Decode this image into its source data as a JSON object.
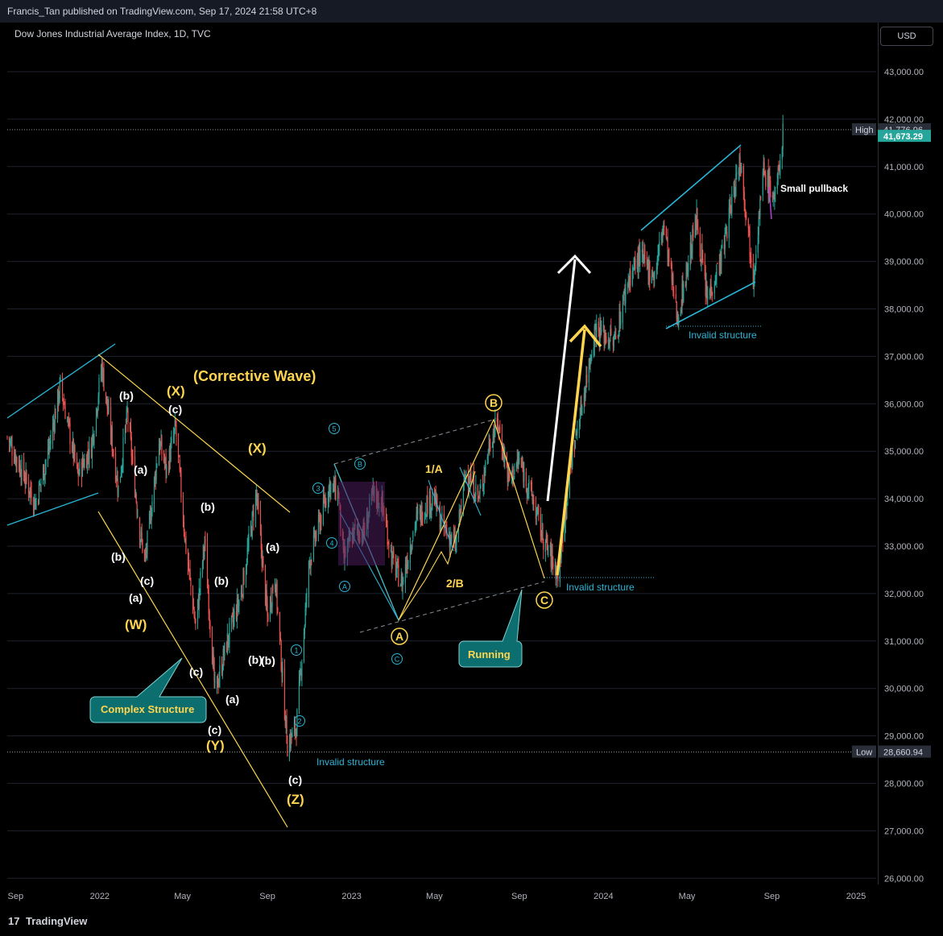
{
  "header": {
    "publish_line": "Francis_Tan published on TradingView.com, Sep 17, 2024 21:58 UTC+8"
  },
  "symbol_line": "Dow Jones Industrial Average Index, 1D, TVC",
  "currency": "USD",
  "footer": {
    "brand": "TradingView"
  },
  "colors": {
    "up": "#26a69a",
    "down": "#ef5350",
    "cyan": "#29b6d8",
    "yellow": "#ffd54f",
    "white": "#ffffff",
    "price_tag": "#26a69a",
    "grid": "#1e222d"
  },
  "chart_data": {
    "type": "candlestick",
    "title": "",
    "y_axis": {
      "ticks": [
        26000,
        27000,
        28000,
        29000,
        30000,
        31000,
        32000,
        33000,
        34000,
        35000,
        36000,
        37000,
        38000,
        39000,
        40000,
        41000,
        42000,
        43000
      ],
      "tick_labels": [
        "26,000.00",
        "27,000.00",
        "28,000.00",
        "29,000.00",
        "30,000.00",
        "31,000.00",
        "32,000.00",
        "33,000.00",
        "34,000.00",
        "35,000.00",
        "36,000.00",
        "37,000.00",
        "38,000.00",
        "39,000.00",
        "40,000.00",
        "41,000.00",
        "42,000.00",
        "43,000.00"
      ],
      "ylim": [
        25800,
        43800
      ]
    },
    "x_axis": {
      "tick_labels": [
        "Sep",
        "2022",
        "May",
        "Sep",
        "2023",
        "May",
        "Sep",
        "2024",
        "May",
        "Sep",
        "2025"
      ],
      "tick_dates": [
        "2021-09-01",
        "2022-01-01",
        "2022-05-01",
        "2022-09-01",
        "2023-01-01",
        "2023-05-01",
        "2023-09-01",
        "2024-01-01",
        "2024-05-01",
        "2024-09-01",
        "2025-01-01"
      ]
    },
    "price_labels": {
      "high_label": "High",
      "high_value": "41,776.96",
      "high": 41776.96,
      "low_label": "Low",
      "low_value": "28,660.94",
      "low": 28660.94,
      "last_value": "41,673.29",
      "last": 41673.29
    },
    "price_path": [
      [
        "2021-08-20",
        35300
      ],
      [
        "2021-09-10",
        34600
      ],
      [
        "2021-09-30",
        33900
      ],
      [
        "2021-10-20",
        35100
      ],
      [
        "2021-11-05",
        36400
      ],
      [
        "2021-11-30",
        34500
      ],
      [
        "2021-12-20",
        35100
      ],
      [
        "2022-01-04",
        36800
      ],
      [
        "2022-01-28",
        34200
      ],
      [
        "2022-02-10",
        35800
      ],
      [
        "2022-02-28",
        33300
      ],
      [
        "2022-03-08",
        32700
      ],
      [
        "2022-03-28",
        35200
      ],
      [
        "2022-04-08",
        34600
      ],
      [
        "2022-04-21",
        35500
      ],
      [
        "2022-05-05",
        33100
      ],
      [
        "2022-05-20",
        31300
      ],
      [
        "2022-06-02",
        33100
      ],
      [
        "2022-06-17",
        29900
      ],
      [
        "2022-07-05",
        31000
      ],
      [
        "2022-07-25",
        32000
      ],
      [
        "2022-08-16",
        34100
      ],
      [
        "2022-09-01",
        31500
      ],
      [
        "2022-09-12",
        32400
      ],
      [
        "2022-09-30",
        28800
      ],
      [
        "2022-10-13",
        29200
      ],
      [
        "2022-11-01",
        32700
      ],
      [
        "2022-11-30",
        34300
      ],
      [
        "2022-12-13",
        34100
      ],
      [
        "2022-12-20",
        32700
      ],
      [
        "2023-01-04",
        33300
      ],
      [
        "2023-01-20",
        33300
      ],
      [
        "2023-02-01",
        34100
      ],
      [
        "2023-02-14",
        33900
      ],
      [
        "2023-03-01",
        32700
      ],
      [
        "2023-03-15",
        32200
      ],
      [
        "2023-04-03",
        33500
      ],
      [
        "2023-04-20",
        33900
      ],
      [
        "2023-05-01",
        34000
      ],
      [
        "2023-05-10",
        33500
      ],
      [
        "2023-06-01",
        33000
      ],
      [
        "2023-06-16",
        34600
      ],
      [
        "2023-07-05",
        34000
      ],
      [
        "2023-07-20",
        35200
      ],
      [
        "2023-08-01",
        35600
      ],
      [
        "2023-08-17",
        34400
      ],
      [
        "2023-09-01",
        34800
      ],
      [
        "2023-09-20",
        34000
      ],
      [
        "2023-10-05",
        33200
      ],
      [
        "2023-10-27",
        32400
      ],
      [
        "2023-11-15",
        34800
      ],
      [
        "2023-12-01",
        36000
      ],
      [
        "2023-12-20",
        37600
      ],
      [
        "2024-01-17",
        37300
      ],
      [
        "2024-02-05",
        38600
      ],
      [
        "2024-02-22",
        39100
      ],
      [
        "2024-03-15",
        38700
      ],
      [
        "2024-03-28",
        39800
      ],
      [
        "2024-04-17",
        37800
      ],
      [
        "2024-05-15",
        39900
      ],
      [
        "2024-05-30",
        38200
      ],
      [
        "2024-06-20",
        39100
      ],
      [
        "2024-07-17",
        41200
      ],
      [
        "2024-08-05",
        38700
      ],
      [
        "2024-08-20",
        40900
      ],
      [
        "2024-09-06",
        40300
      ],
      [
        "2024-09-17",
        41673
      ]
    ],
    "annotations": {
      "corrective_wave": "(Corrective Wave)",
      "complex_structure": "Complex Structure",
      "running": "Running",
      "small_pullback": "Small pullback",
      "invalid_1": "Invalid structure",
      "invalid_2": "Invalid structure",
      "invalid_3": "Invalid structure",
      "white_labels": [
        "(b)",
        "(c)",
        "(a)",
        "(b)",
        "(c)",
        "(b)",
        "(a)",
        "(b)",
        "(a)",
        "(c)",
        "(b)",
        "(a)",
        "(b)",
        "(c)",
        "(c)"
      ],
      "yellow_labels": [
        "(X)",
        "(X)",
        "(W)",
        "(Y)",
        "(Z)",
        "1/A",
        "2/B"
      ],
      "yellow_circle_labels": [
        "B",
        "A",
        "C"
      ],
      "cyan_circle_labels": [
        "5",
        "B",
        "3",
        "4",
        "A",
        "C",
        "1",
        "2"
      ]
    }
  }
}
